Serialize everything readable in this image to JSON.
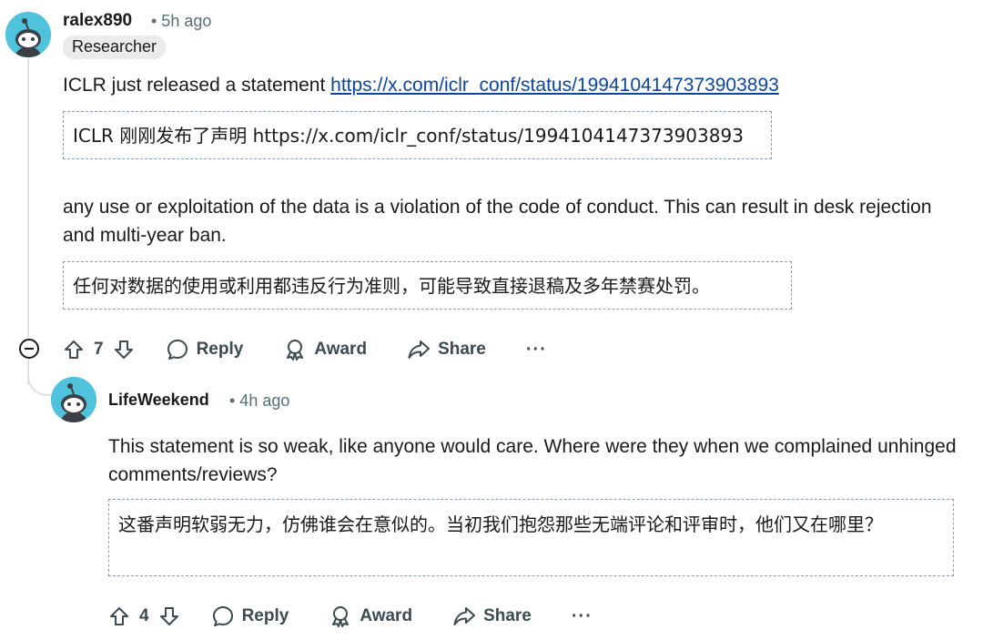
{
  "comments": [
    {
      "author": "ralex890",
      "time": "• 5h ago",
      "flair": "Researcher",
      "text_before_link": "ICLR just released a statement ",
      "link_text": "https://x.com/iclr_conf/status/1994104147373903893",
      "translation_1": "ICLR 刚刚发布了声明 https://x.com/iclr_conf/status/1994104147373903893",
      "paragraph_2": "any use or exploitation of the data is a violation of the code of conduct. This can result in desk rejection and multi-year ban.",
      "translation_2": "任何对数据的使用或利用都违反行为准则，可能导致直接退稿及多年禁赛处罚。",
      "votes": "7",
      "actions": {
        "reply": "Reply",
        "award": "Award",
        "share": "Share",
        "more": "···"
      }
    },
    {
      "author": "LifeWeekend",
      "time": "• 4h ago",
      "text": "This statement is so weak, like anyone would care. Where were they when we complained unhinged comments/reviews?",
      "translation": "这番声明软弱无力，仿佛谁会在意似的。当初我们抱怨那些无端评论和评审时，他们又在哪里？",
      "votes": "4",
      "actions": {
        "reply": "Reply",
        "award": "Award",
        "share": "Share",
        "more": "···"
      }
    }
  ],
  "icons": {
    "avatar": "snoo-avatar-icon",
    "collapse": "collapse-minus-icon",
    "upvote": "arrow-up-icon",
    "downvote": "arrow-down-icon",
    "reply": "speech-bubble-icon",
    "award": "award-icon",
    "share": "share-arrow-icon"
  },
  "colors": {
    "avatar_bg": "#4fc3dc",
    "link": "#0a45a8",
    "meta": "#576f76",
    "translation_border": "#8a9bb8"
  }
}
